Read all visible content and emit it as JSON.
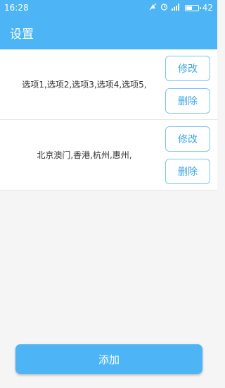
{
  "status_bar": {
    "time": "16:28",
    "signal_label": "4G",
    "battery_percent": "42"
  },
  "app_bar": {
    "title": "设置"
  },
  "rows": [
    {
      "text": "选项1,选项2,选项3,选项4,选项5,",
      "edit_label": "修改",
      "delete_label": "删除"
    },
    {
      "text": "北京澳门,香港,杭州,惠州,",
      "edit_label": "修改",
      "delete_label": "删除"
    }
  ],
  "add_button": {
    "label": "添加"
  },
  "colors": {
    "primary": "#4db5f6",
    "button_border": "#7ac7f4",
    "button_text": "#3aa5e8"
  }
}
